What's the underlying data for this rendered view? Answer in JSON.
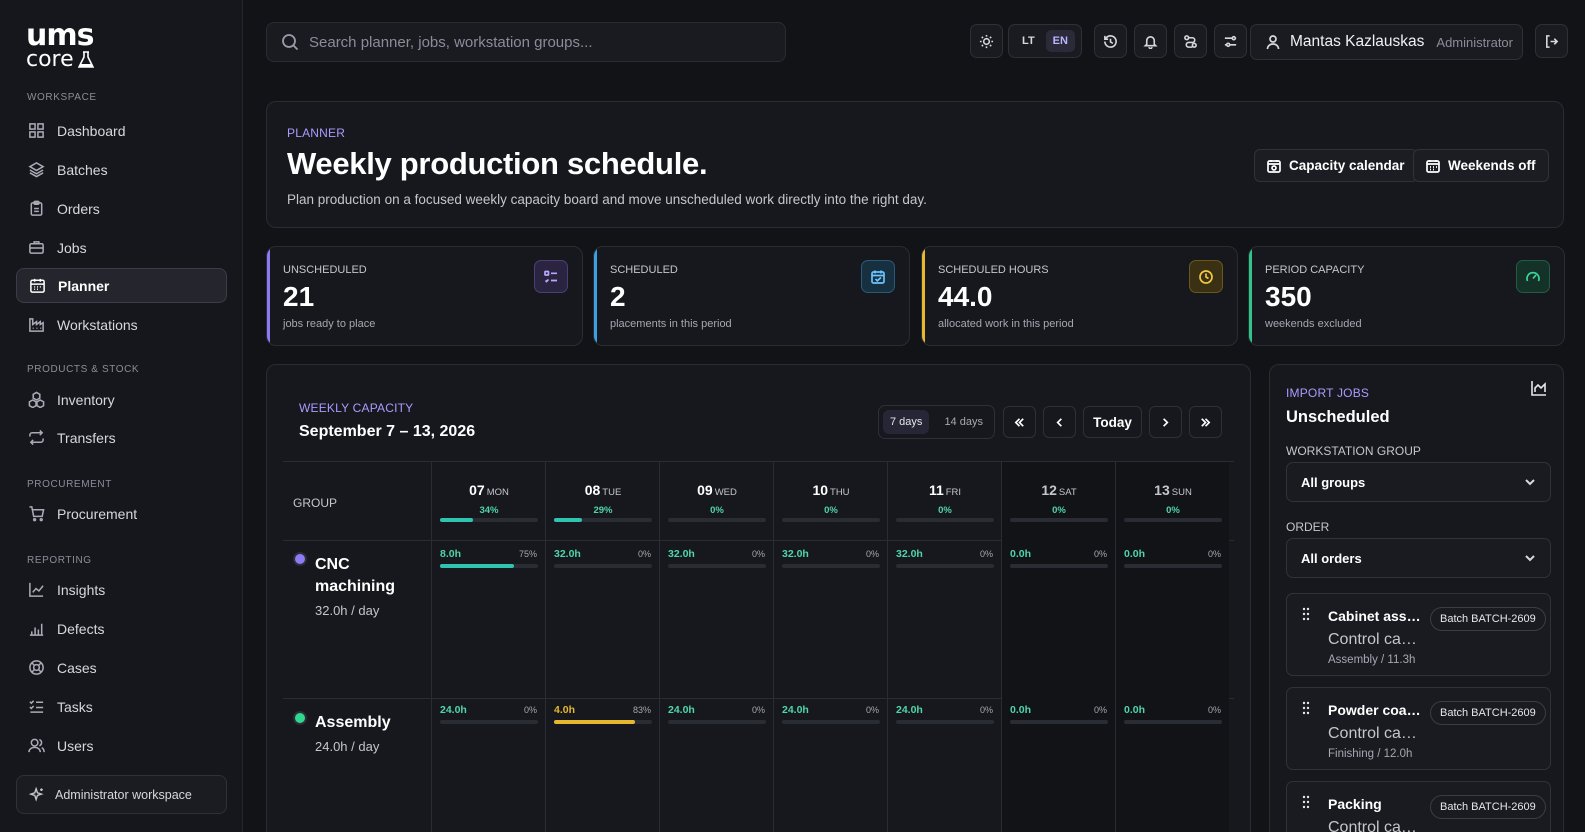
{
  "brand": {
    "line1": "ums",
    "line2": "core"
  },
  "sidebar": {
    "sections": {
      "workspace": "WORKSPACE",
      "products": "PRODUCTS & STOCK",
      "procurement": "PROCUREMENT",
      "reporting": "REPORTING"
    },
    "items": {
      "dashboard": "Dashboard",
      "batches": "Batches",
      "orders": "Orders",
      "jobs": "Jobs",
      "planner": "Planner",
      "workstations": "Workstations",
      "inventory": "Inventory",
      "transfers": "Transfers",
      "procurement": "Procurement",
      "insights": "Insights",
      "defects": "Defects",
      "cases": "Cases",
      "tasks": "Tasks",
      "users": "Users"
    },
    "admin_workspace": "Administrator workspace"
  },
  "topbar": {
    "search_placeholder": "Search planner, jobs, workstation groups...",
    "lang_lt": "LT",
    "lang_en": "EN",
    "user_name": "Mantas Kazlauskas",
    "user_role": "Administrator"
  },
  "header": {
    "eyebrow": "PLANNER",
    "title": "Weekly production schedule.",
    "description": "Plan production on a focused weekly capacity board and move unscheduled work directly into the right day.",
    "capacity_calendar": "Capacity calendar",
    "weekends_off": "Weekends off"
  },
  "stats": [
    {
      "label": "UNSCHEDULED",
      "value": "21",
      "sub": "jobs ready to place",
      "color": "#8b7cf6"
    },
    {
      "label": "SCHEDULED",
      "value": "2",
      "sub": "placements in this period",
      "color": "#3ba0e6"
    },
    {
      "label": "SCHEDULED HOURS",
      "value": "44.0",
      "sub": "allocated work in this period",
      "color": "#e6b82e"
    },
    {
      "label": "PERIOD CAPACITY",
      "value": "350",
      "sub": "weekends excluded",
      "color": "#2fc48a"
    }
  ],
  "capacity": {
    "eyebrow": "WEEKLY CAPACITY",
    "range": "September 7 – 13, 2026",
    "view_7": "7 days",
    "view_14": "14 days",
    "today": "Today",
    "group_header": "GROUP",
    "days": [
      {
        "num": "07",
        "dow": "MON",
        "pct": "34%",
        "fill": 0.34,
        "weekend": false
      },
      {
        "num": "08",
        "dow": "TUE",
        "pct": "29%",
        "fill": 0.29,
        "weekend": false
      },
      {
        "num": "09",
        "dow": "WED",
        "pct": "0%",
        "fill": 0,
        "weekend": false
      },
      {
        "num": "10",
        "dow": "THU",
        "pct": "0%",
        "fill": 0,
        "weekend": false
      },
      {
        "num": "11",
        "dow": "FRI",
        "pct": "0%",
        "fill": 0,
        "weekend": false
      },
      {
        "num": "12",
        "dow": "SAT",
        "pct": "0%",
        "fill": 0,
        "weekend": true
      },
      {
        "num": "13",
        "dow": "SUN",
        "pct": "0%",
        "fill": 0,
        "weekend": true
      }
    ],
    "groups": [
      {
        "name_l1": "CNC",
        "name_l2": "machining",
        "per_day": "32.0h / day",
        "dot": "#8b7cf6",
        "cells": [
          {
            "h": "8.0h",
            "p": "75%",
            "fill": 0.75,
            "color": "#2fc4b0"
          },
          {
            "h": "32.0h",
            "p": "0%",
            "fill": 0,
            "color": "#2fc4b0"
          },
          {
            "h": "32.0h",
            "p": "0%",
            "fill": 0,
            "color": "#2fc4b0"
          },
          {
            "h": "32.0h",
            "p": "0%",
            "fill": 0,
            "color": "#2fc4b0"
          },
          {
            "h": "32.0h",
            "p": "0%",
            "fill": 0,
            "color": "#2fc4b0"
          },
          {
            "h": "0.0h",
            "p": "0%",
            "fill": 0,
            "color": "#2fc4b0"
          },
          {
            "h": "0.0h",
            "p": "0%",
            "fill": 0,
            "color": "#2fc4b0"
          }
        ]
      },
      {
        "name_l1": "Assembly",
        "name_l2": "",
        "per_day": "24.0h / day",
        "dot": "#2fd88f",
        "cells": [
          {
            "h": "24.0h",
            "p": "0%",
            "fill": 0,
            "color": "#2fc4b0"
          },
          {
            "h": "4.0h",
            "p": "83%",
            "fill": 0.83,
            "color": "#e6b82e"
          },
          {
            "h": "24.0h",
            "p": "0%",
            "fill": 0,
            "color": "#2fc4b0"
          },
          {
            "h": "24.0h",
            "p": "0%",
            "fill": 0,
            "color": "#2fc4b0"
          },
          {
            "h": "24.0h",
            "p": "0%",
            "fill": 0,
            "color": "#2fc4b0"
          },
          {
            "h": "0.0h",
            "p": "0%",
            "fill": 0,
            "color": "#2fc4b0"
          },
          {
            "h": "0.0h",
            "p": "0%",
            "fill": 0,
            "color": "#2fc4b0"
          }
        ]
      }
    ]
  },
  "import": {
    "eyebrow": "IMPORT JOBS",
    "title": "Unscheduled",
    "group_label": "WORKSTATION GROUP",
    "group_value": "All groups",
    "order_label": "ORDER",
    "order_value": "All orders",
    "jobs": [
      {
        "title": "Cabinet assembly",
        "sub": "Control cabinet",
        "meta": "Assembly / 11.3h",
        "batch": "Batch BATCH-2609"
      },
      {
        "title": "Powder coating",
        "sub": "Control cabinet",
        "meta": "Finishing / 12.0h",
        "batch": "Batch BATCH-2609"
      },
      {
        "title": "Packing",
        "sub": "Control cabinet",
        "meta": "",
        "batch": "Batch BATCH-2609"
      }
    ]
  }
}
